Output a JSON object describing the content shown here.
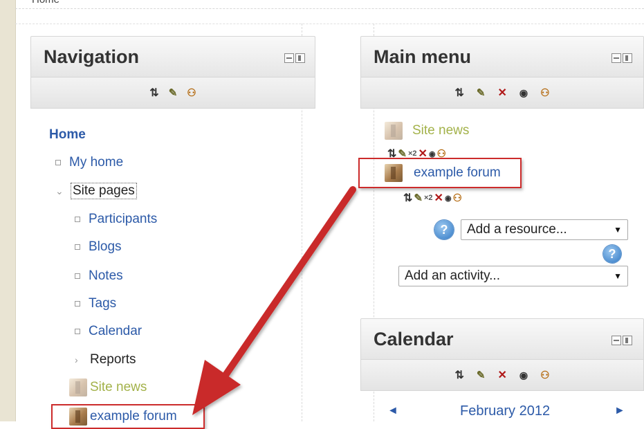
{
  "breadcrumb": {
    "home": "Home"
  },
  "navigation": {
    "title": "Navigation",
    "items": [
      {
        "label": "Home"
      },
      {
        "label": "My home"
      },
      {
        "label": "Site pages"
      },
      {
        "label": "Participants"
      },
      {
        "label": "Blogs"
      },
      {
        "label": "Notes"
      },
      {
        "label": "Tags"
      },
      {
        "label": "Calendar"
      },
      {
        "label": "Reports"
      },
      {
        "label": "Site news"
      },
      {
        "label": "example forum"
      }
    ]
  },
  "main_menu": {
    "title": "Main menu",
    "items": [
      {
        "label": "Site news"
      },
      {
        "label": "example forum"
      }
    ],
    "indent_text": "×2",
    "add_resource": "Add a resource...",
    "add_activity": "Add an activity...",
    "help_glyph": "?"
  },
  "calendar": {
    "title": "Calendar",
    "month": "February 2012",
    "prev": "◄",
    "next": "►"
  },
  "colors": {
    "annotation": "#cc2b2b",
    "link": "#2c5aa8"
  }
}
